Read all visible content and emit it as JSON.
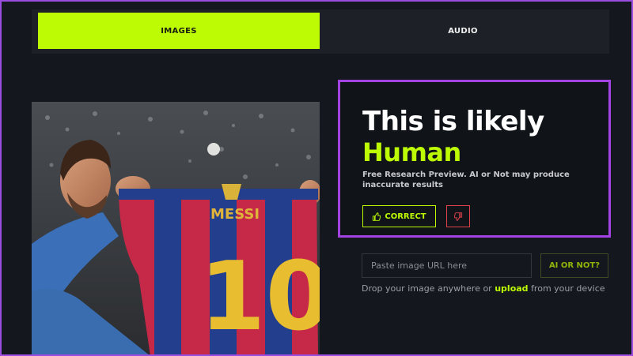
{
  "tabs": [
    {
      "label": "IMAGES",
      "active": true
    },
    {
      "label": "AUDIO",
      "active": false
    }
  ],
  "result": {
    "heading": "This is likely",
    "verdict": "Human",
    "disclaimer": "Free Research Preview. AI or Not may produce inaccurate results",
    "correct_label": "CORRECT",
    "correct_icon": "thumbs-up-icon",
    "incorrect_icon": "thumbs-down-icon"
  },
  "url_form": {
    "placeholder": "Paste image URL here",
    "value": "",
    "submit_label": "AI OR NOT?"
  },
  "drop_hint": {
    "before": "Drop your image anywhere or",
    "link": "upload",
    "after": "from your device"
  },
  "colors": {
    "accent": "#bdfb04",
    "highlight_border": "#a243e2",
    "background": "#14171d",
    "incorrect": "#e0414b"
  }
}
